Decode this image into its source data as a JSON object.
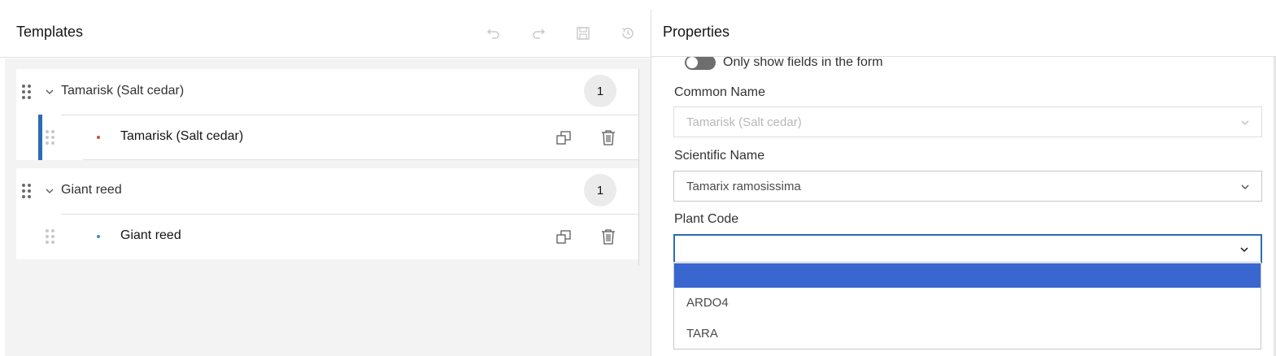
{
  "templates_panel": {
    "title": "Templates",
    "toolbar": {
      "undo_icon": "undo-icon",
      "redo_icon": "redo-icon",
      "save_icon": "save-icon",
      "history_icon": "history-icon"
    },
    "groups": [
      {
        "label": "Tamarisk (Salt cedar)",
        "count": "1",
        "item": {
          "label": "Tamarisk (Salt cedar)",
          "dot_color": "#c9503a",
          "selected": true
        }
      },
      {
        "label": "Giant reed",
        "count": "1",
        "item": {
          "label": "Giant reed",
          "dot_color": "#3a8fc9",
          "selected": false
        }
      }
    ]
  },
  "properties_panel": {
    "title": "Properties",
    "toggle_label": "Only show fields in the form",
    "fields": [
      {
        "label": "Common Name",
        "value": "Tamarisk (Salt cedar)",
        "disabled": true
      },
      {
        "label": "Scientific Name",
        "value": "Tamarix ramosissima",
        "disabled": false
      },
      {
        "label": "Plant Code",
        "value": "",
        "disabled": false
      }
    ],
    "dropdown_options": [
      "",
      "ARDO4",
      "TARA"
    ],
    "selected_option_index": 0
  },
  "colors": {
    "accent": "#2b6cb4",
    "selected_option": "#3a66d0"
  }
}
